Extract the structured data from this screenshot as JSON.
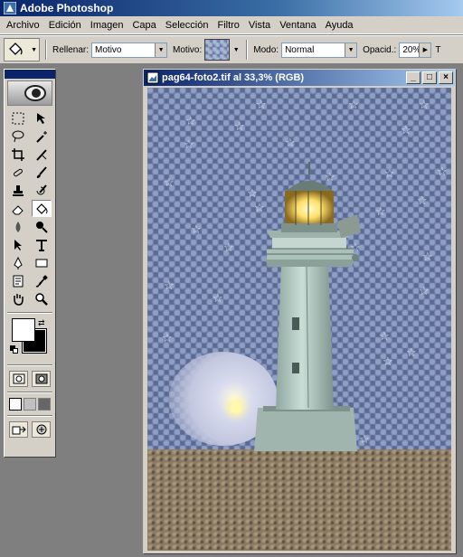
{
  "app": {
    "title": "Adobe Photoshop"
  },
  "menu": [
    "Archivo",
    "Edición",
    "Imagen",
    "Capa",
    "Selección",
    "Filtro",
    "Vista",
    "Ventana",
    "Ayuda"
  ],
  "options": {
    "fill_label": "Rellenar:",
    "fill_value": "Motivo",
    "pattern_label": "Motivo:",
    "mode_label": "Modo:",
    "mode_value": "Normal",
    "opacity_label": "Opacid.:",
    "opacity_value": "20%",
    "truncated_label": "T"
  },
  "document": {
    "title": "pag64-foto2.tif al 33,3% (RGB)",
    "minimize": "_",
    "maximize": "□",
    "close": "×"
  },
  "toolbox": {
    "tools": [
      "marquee-icon",
      "move-icon",
      "lasso-icon",
      "magic-wand-icon",
      "crop-icon",
      "slice-icon",
      "healing-brush-icon",
      "brush-icon",
      "clone-stamp-icon",
      "history-brush-icon",
      "eraser-icon",
      "paint-bucket-icon",
      "blur-icon",
      "dodge-icon",
      "path-selection-icon",
      "type-icon",
      "pen-icon",
      "rectangle-icon",
      "notes-icon",
      "eyedropper-icon",
      "hand-icon",
      "zoom-icon"
    ],
    "active_tool": "paint-bucket-icon",
    "foreground_color": "#ffffff",
    "background_color": "#000000"
  }
}
